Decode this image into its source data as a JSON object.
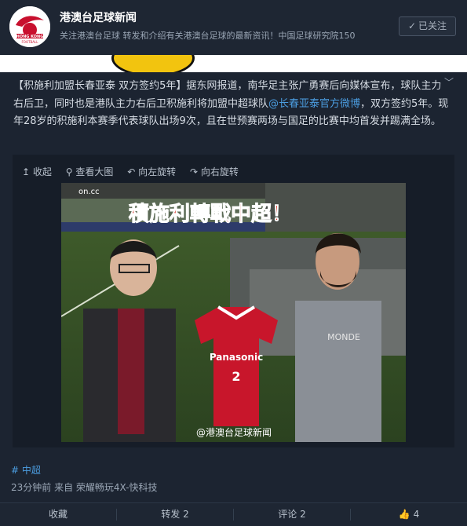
{
  "account": {
    "name": "港澳台足球新闻",
    "description": "关注港澳台足球 转发和介绍有关港澳台足球的最新资讯！中国足球研究院150",
    "follow_label": "已关注",
    "avatar_text_top": "HONG KONG",
    "avatar_text_bottom": "FOOTBALL"
  },
  "post": {
    "text_prefix": "【积施利加盟长春亚泰 双方签约5年】据东网报道，南华足主张广勇赛后向媒体宣布，球队主力右后卫，同时也是港队主力右后卫积施利将加盟中超球队",
    "mention": "@长春亚泰官方微博",
    "text_suffix": "，双方签约5年。现年28岁的积施利本赛季代表球队出场9次，且在世预赛两场与国足的比赛中均首发并踢满全场。"
  },
  "media_tools": {
    "collapse": "收起",
    "view_large": "查看大图",
    "rotate_left": "向左旋转",
    "rotate_right": "向右旋转"
  },
  "photo": {
    "headline": "積施利轉戰中超！",
    "site_logo": "on.cc",
    "watermark": "@港澳台足球新闻",
    "jersey_sponsor": "Panasonic",
    "jersey_number": "2",
    "shirt_text": "MONDE"
  },
  "topic": "中超",
  "meta": {
    "time": "23分钟前",
    "source": "来自 荣耀畅玩4X-快科技"
  },
  "actions": {
    "favorite": "收藏",
    "repost": "转发 2",
    "comment": "评论 2",
    "like": "4"
  },
  "colors": {
    "background": "#1b2330",
    "link": "#4b9de0",
    "headline_red": "#d42a1f"
  }
}
